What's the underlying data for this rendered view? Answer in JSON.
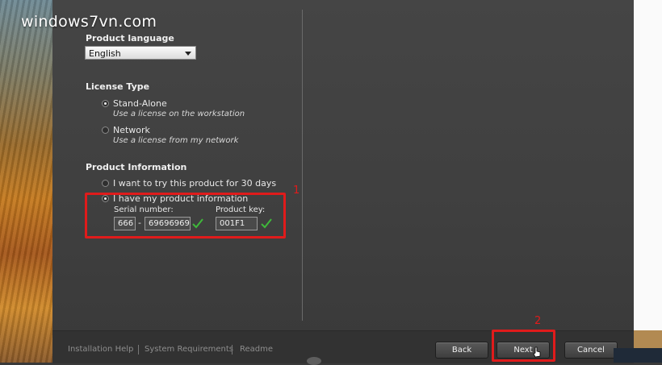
{
  "watermark": "windows7vn.com",
  "product_language": {
    "heading": "Product language",
    "selected": "English"
  },
  "license_type": {
    "heading": "License Type",
    "options": [
      {
        "label": "Stand-Alone",
        "description": "Use a license on the workstation",
        "selected": true
      },
      {
        "label": "Network",
        "description": "Use a license from my network",
        "selected": false
      }
    ]
  },
  "product_information": {
    "heading": "Product Information",
    "options": [
      {
        "label": "I want to try this product for 30 days",
        "selected": false
      },
      {
        "label": "I have my product information",
        "selected": true
      }
    ],
    "serial_label": "Serial number:",
    "serial_prefix": "666",
    "serial_separator": "-",
    "serial_number": "69696969",
    "key_label": "Product key:",
    "product_key": "001F1"
  },
  "annotations": {
    "marker_1": "1",
    "marker_2": "2",
    "color": "#e01b1b"
  },
  "footer": {
    "links": [
      "Installation Help",
      "System Requirements",
      "Readme"
    ],
    "buttons": {
      "back": "Back",
      "next": "Next",
      "cancel": "Cancel"
    }
  },
  "colors": {
    "check": "#3fb83a",
    "dialog": "#404040"
  }
}
